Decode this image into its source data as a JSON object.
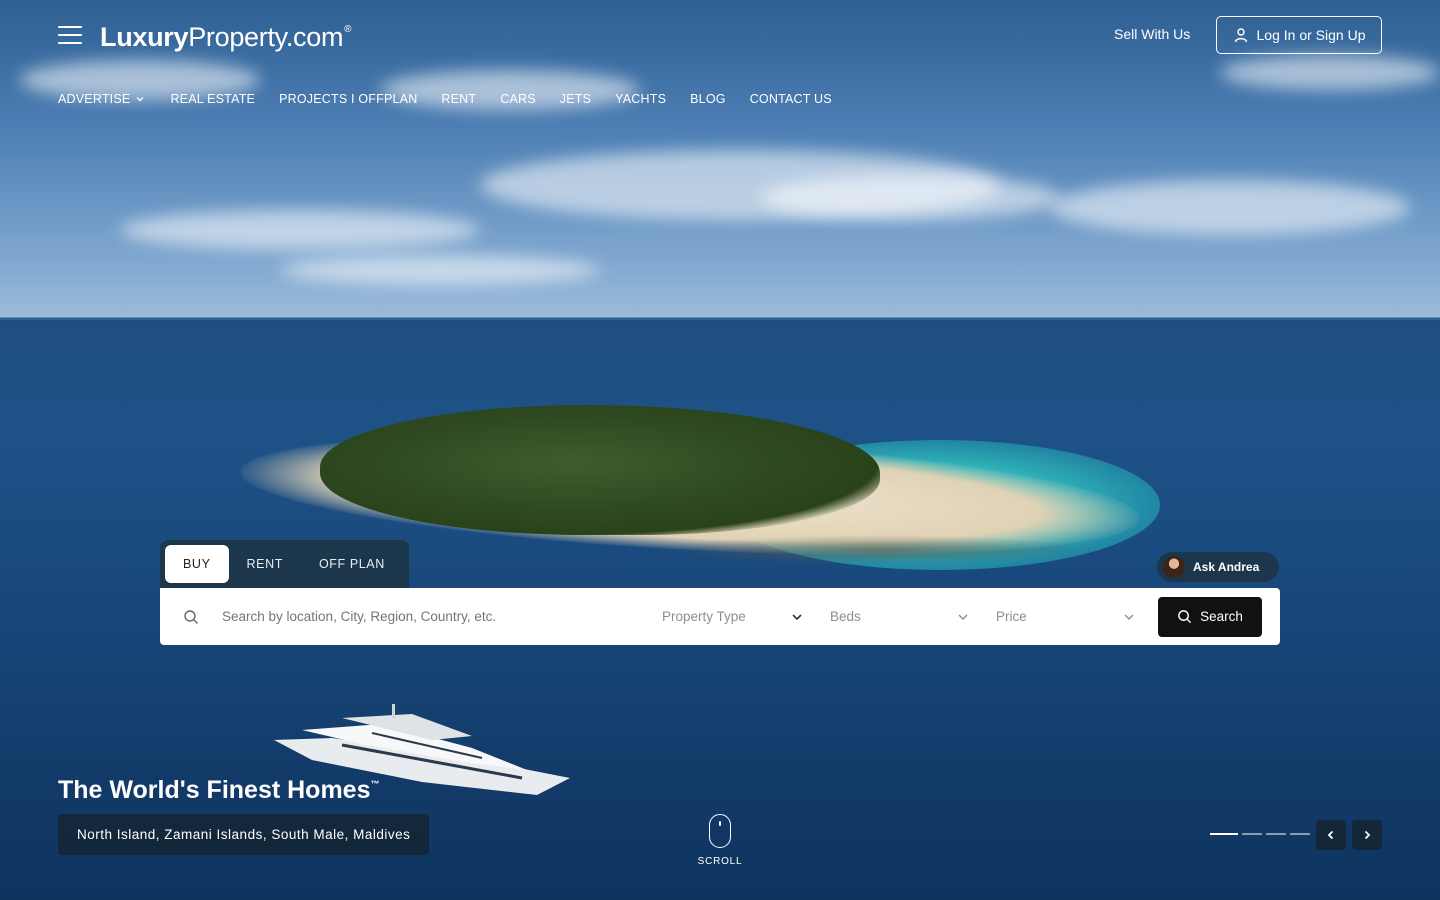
{
  "header": {
    "logo_bold": "Luxury",
    "logo_light": "Property.com",
    "logo_mark": "®",
    "sell_label": "Sell With Us",
    "login_label": "Log In or Sign Up"
  },
  "nav": {
    "items": [
      {
        "label": "ADVERTISE",
        "has_dropdown": true
      },
      {
        "label": "REAL ESTATE"
      },
      {
        "label": "PROJECTS I OFFPLAN"
      },
      {
        "label": "RENT"
      },
      {
        "label": "CARS"
      },
      {
        "label": "JETS"
      },
      {
        "label": "YACHTS"
      },
      {
        "label": "BLOG"
      },
      {
        "label": "CONTACT US"
      }
    ]
  },
  "search": {
    "tabs": [
      "BUY",
      "RENT",
      "OFF PLAN"
    ],
    "active_tab": "BUY",
    "placeholder": "Search by location, City, Region, Country, etc.",
    "property_type": "Property Type",
    "beds": "Beds",
    "price": "Price",
    "button_label": "Search",
    "assistant_label": "Ask Andrea"
  },
  "hero": {
    "headline": "The World's Finest Homes",
    "headline_mark": "™",
    "location": "North Island, Zamani Islands, South Male, Maldives",
    "scroll_label": "SCROLL",
    "slide_count": 4,
    "active_slide": 1
  },
  "colors": {
    "search_button": "#111111",
    "overlay_panel": "#1e323c"
  }
}
